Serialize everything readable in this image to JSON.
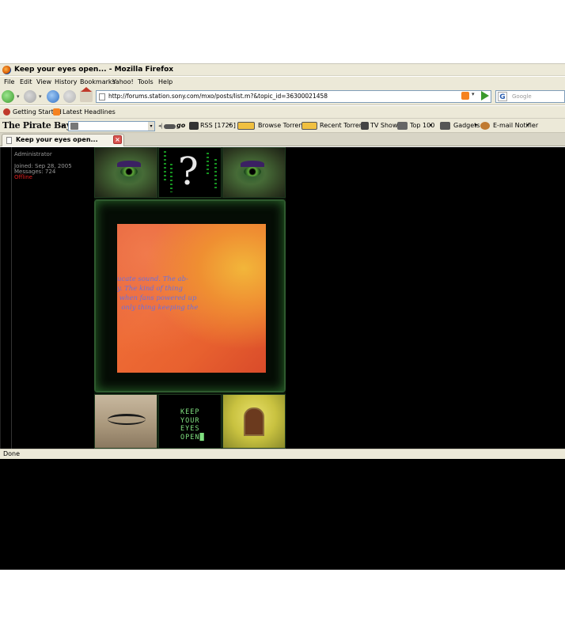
{
  "window": {
    "title": "Keep your eyes open... - Mozilla Firefox"
  },
  "menu": [
    "File",
    "Edit",
    "View",
    "History",
    "Bookmarks",
    "Yahoo!",
    "Tools",
    "Help"
  ],
  "navigation": {
    "url": "http://forums.station.sony.com/mxo/posts/list.m?&topic_id=36300021458",
    "search_placeholder": "Google",
    "search_engine_icon": "G"
  },
  "bookmarks": [
    "Getting Started",
    "Latest Headlines"
  ],
  "tpb_toolbar": {
    "logo": "The Pirate Bay",
    "go_label": "go",
    "rss": "RSS [1725]",
    "browse": "Browse Torrents",
    "recent": "Recent Torrents",
    "tv": "TV Shows",
    "top": "Top 100",
    "gadgets": "Gadgets",
    "email": "E-mail Notifier"
  },
  "tab": {
    "label": "Keep your eyes open...",
    "close": "×"
  },
  "user": {
    "role": "Administrator",
    "joined": "Joined: Sep 28, 2005",
    "messages": "Messages: 724",
    "status": "Offline"
  },
  "signature": {
    "question": "?",
    "center_text": "ucate sound. The ab-\ny. The kind of thing\n when fans powered up\n  only thing keeping the",
    "kyeo_text": "KEEP\nYOUR\nEYES\nOPEN█"
  },
  "status": {
    "text": "Done"
  },
  "colors": {
    "chrome": "#ece9d8",
    "page_bg": "#000000",
    "offline": "#e02020",
    "terminal_green": "#7fe07f"
  }
}
